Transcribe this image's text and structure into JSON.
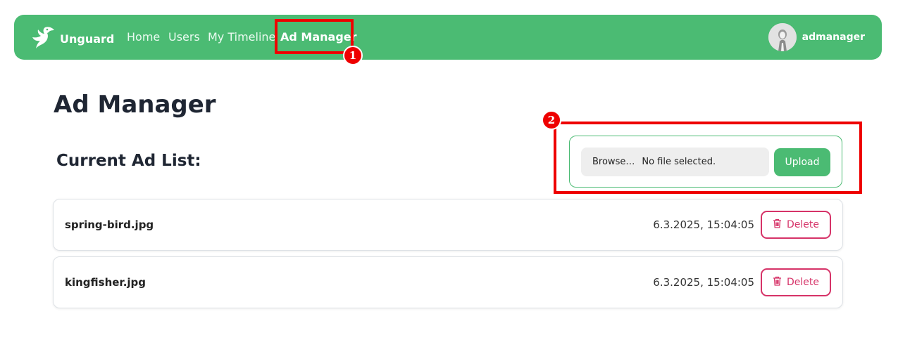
{
  "nav": {
    "brand": "Unguard",
    "links": [
      "Home",
      "Users",
      "My Timeline",
      "Ad Manager"
    ],
    "user": "admanager"
  },
  "page": {
    "title": "Ad Manager",
    "section_title": "Current Ad List:"
  },
  "upload": {
    "browse_label": "Browse…",
    "file_status": "No file selected.",
    "upload_label": "Upload"
  },
  "ads": [
    {
      "name": "spring-bird.jpg",
      "date": "6.3.2025, 15:04:05",
      "delete_label": "Delete"
    },
    {
      "name": "kingfisher.jpg",
      "date": "6.3.2025, 15:04:05",
      "delete_label": "Delete"
    }
  ],
  "markers": [
    "1",
    "2"
  ],
  "colors": {
    "brand_green": "#4bbb73",
    "delete_pink": "#d63368",
    "marker_red": "#ee0000"
  },
  "icons": {
    "brand": "hummingbird-logo-icon",
    "delete": "trash-icon"
  }
}
